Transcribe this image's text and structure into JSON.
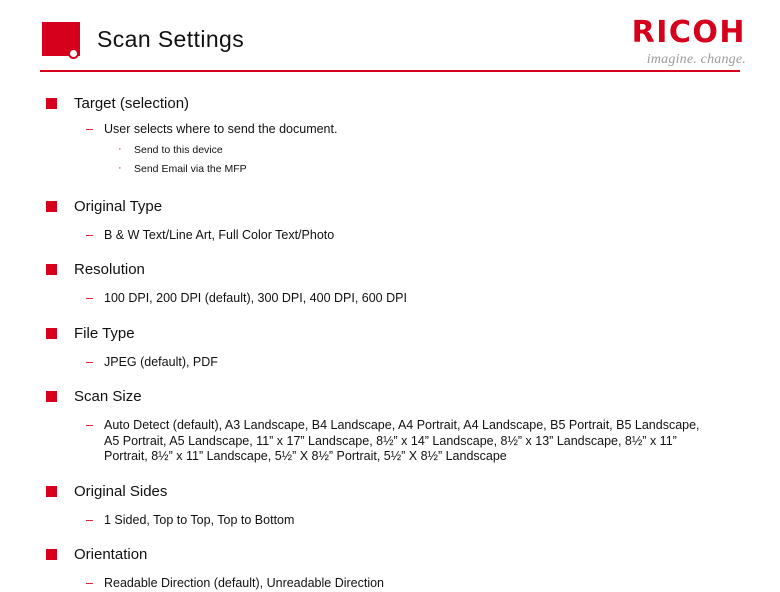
{
  "header": {
    "title": "Scan Settings",
    "brand_name": "RICOH",
    "brand_tagline": "imagine. change.",
    "accent_color": "#d6001c"
  },
  "sections": [
    {
      "heading": "Target (selection)",
      "detail": "User selects where to send the document.",
      "subitems": [
        "Send to this device",
        "Send Email via the MFP"
      ]
    },
    {
      "heading": "Original Type",
      "detail": "B & W Text/Line Art, Full Color Text/Photo",
      "subitems": []
    },
    {
      "heading": "Resolution",
      "detail": "100 DPI, 200 DPI (default), 300 DPI, 400 DPI, 600 DPI",
      "subitems": []
    },
    {
      "heading": "File Type",
      "detail": "JPEG (default), PDF",
      "subitems": []
    },
    {
      "heading": "Scan Size",
      "detail": "Auto Detect (default), A3 Landscape, B4 Landscape, A4 Portrait, A4 Landscape, B5 Portrait, B5 Landscape, A5 Portrait, A5 Landscape, 11” x 17” Landscape, 8½” x 14” Landscape, 8½” x 13” Landscape, 8½” x 11” Portrait, 8½” x 11” Landscape, 5½” X 8½” Portrait, 5½” X 8½” Landscape",
      "subitems": []
    },
    {
      "heading": "Original Sides",
      "detail": "1 Sided, Top to Top, Top to Bottom",
      "subitems": []
    },
    {
      "heading": "Orientation",
      "detail": "Readable Direction (default), Unreadable Direction",
      "subitems": []
    }
  ],
  "glyphs": {
    "bullet_square": "",
    "bullet_dash": "–",
    "bullet_dot": "·"
  }
}
